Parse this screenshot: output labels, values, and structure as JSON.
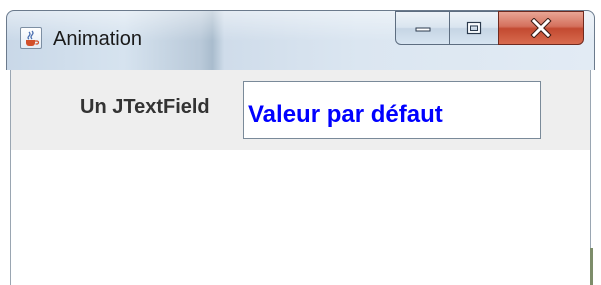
{
  "window": {
    "title": "Animation",
    "icon": "java-cup-icon",
    "controls": {
      "minimize_icon": "minimize-icon",
      "maximize_icon": "maximize-icon",
      "close_label": "X"
    }
  },
  "form": {
    "label": "Un JTextField",
    "field_value": "Valeur par défaut",
    "field_color": "#0000ff"
  },
  "colors": {
    "close_button": "#c34a31",
    "panel_background": "#eeeeee",
    "title_text": "#1a1a1a"
  }
}
